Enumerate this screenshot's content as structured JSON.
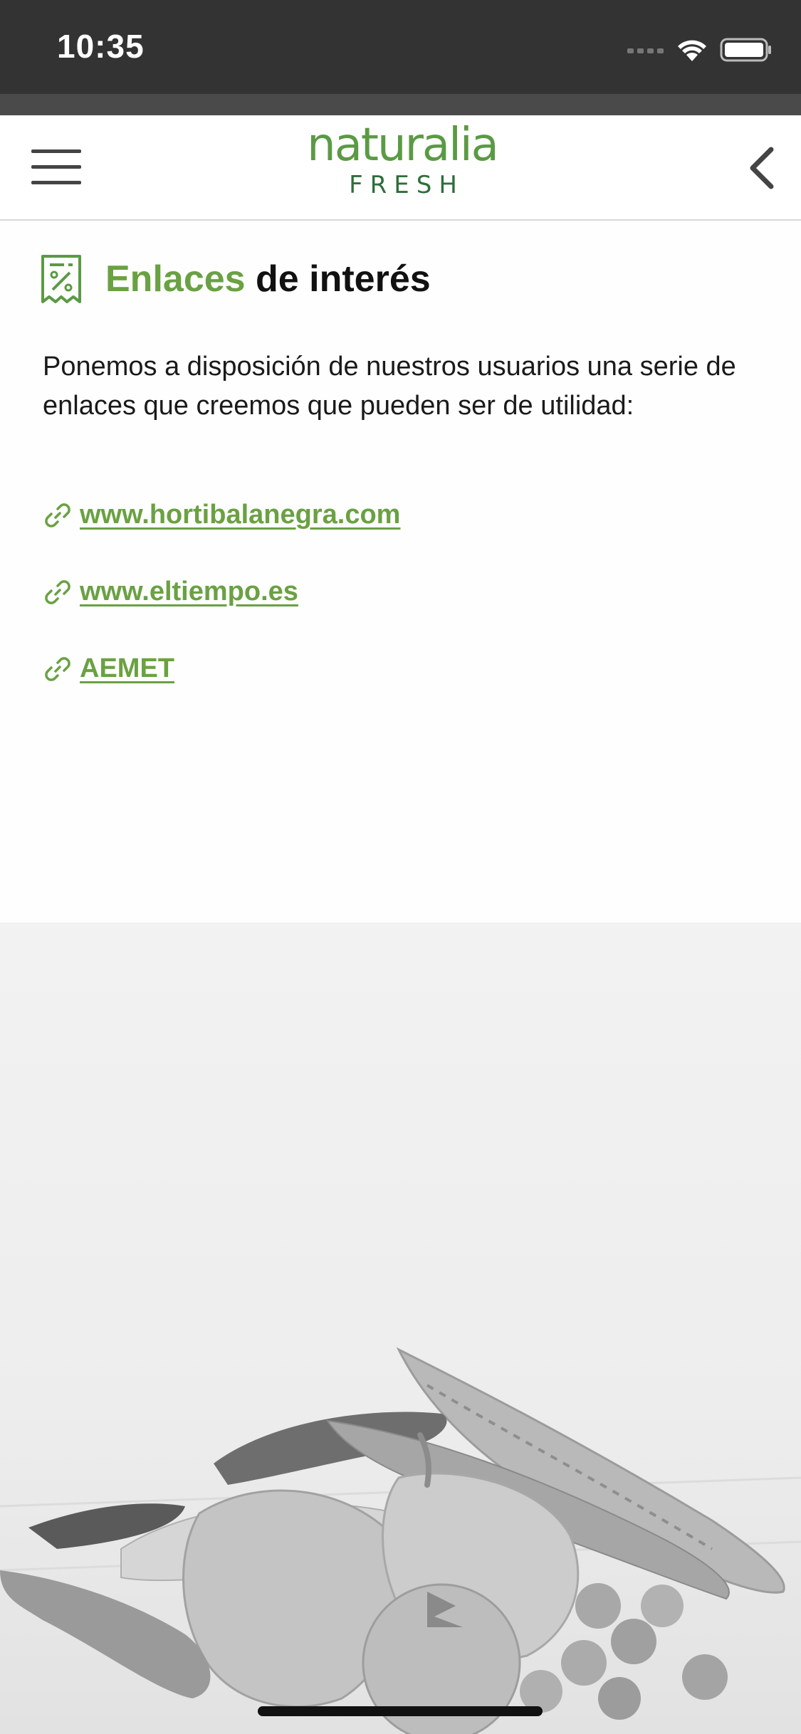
{
  "status_bar": {
    "time": "10:35"
  },
  "header": {
    "logo_main": "naturalia",
    "logo_sub": "FRESH"
  },
  "page": {
    "title_accent": "Enlaces",
    "title_rest": " de interés",
    "intro": "Ponemos a disposición de nuestros usuarios una serie de enlaces que creemos que pueden ser de utilidad:",
    "links": [
      {
        "label": " www.hortibalanegra.com"
      },
      {
        "label": " www.eltiempo.es"
      },
      {
        "label": " AEMET"
      }
    ]
  },
  "colors": {
    "accent": "#6aa142",
    "logo_green": "#5b9a44",
    "status_bar": "#333333"
  },
  "icons": [
    "signal-dots-icon",
    "wifi-icon",
    "battery-icon",
    "hamburger-menu-icon",
    "back-chevron-icon",
    "receipt-percent-icon",
    "link-icon"
  ]
}
